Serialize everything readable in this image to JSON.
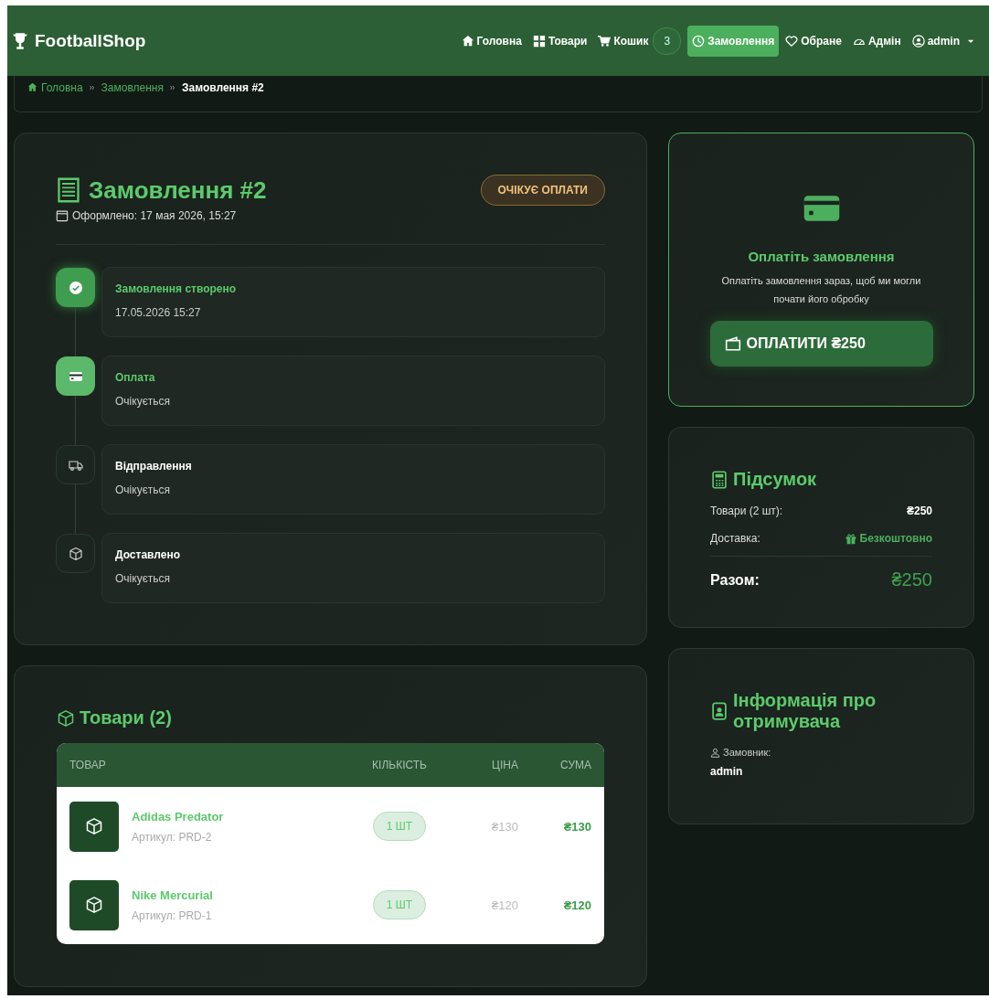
{
  "navbar": {
    "brand": "FootballShop",
    "items": [
      {
        "label": "Головна",
        "selected": false
      },
      {
        "label": "Товари",
        "selected": false
      },
      {
        "label": "Кошик",
        "selected": false,
        "badge": "3"
      },
      {
        "label": "Замовлення",
        "selected": true
      },
      {
        "label": "Обране",
        "selected": false
      },
      {
        "label": "Адмін",
        "selected": false
      },
      {
        "label": "admin",
        "selected": false
      }
    ]
  },
  "breadcrumb": [
    "Головна",
    "Замовлення",
    "Замовлення #2"
  ],
  "order": {
    "title": "Замовлення #2",
    "status": "ОЧІКУЄ ОПЛАТИ",
    "placed": "Оформлено: 17 мая 2026, 15:27",
    "timeline": [
      {
        "title": "Замовлення створено",
        "detail": "17.05.2026 15:27",
        "completed": true,
        "current": false
      },
      {
        "title": "Оплата",
        "detail": "Очікується",
        "completed": false,
        "current": true
      },
      {
        "title": "Відправлення",
        "detail": "Очікується",
        "completed": false,
        "current": false
      },
      {
        "title": "Доставлено",
        "detail": "Очікується",
        "completed": false,
        "current": false
      }
    ]
  },
  "products": {
    "title": "Товари (2)",
    "columns": [
      "ТОВАР",
      "КІЛЬКІСТЬ",
      "ЦІНА",
      "СУМА"
    ],
    "rows": [
      {
        "name": "Adidas Predator",
        "sku": "Артикул: PRD-2",
        "qty": "1 ШТ",
        "price": "₴130",
        "sum": "₴130"
      },
      {
        "name": "Nike Mercurial",
        "sku": "Артикул: PRD-1",
        "qty": "1 ШТ",
        "price": "₴120",
        "sum": "₴120"
      }
    ]
  },
  "payment": {
    "title": "Оплатіть замовлення",
    "text": "Оплатіть замовлення зараз, щоб ми могли почати його обробку",
    "button": "ОПЛАТИТИ ₴250"
  },
  "summary": {
    "title": "Підсумок",
    "rows": [
      {
        "label": "Товари (2 шт):",
        "value": "₴250",
        "kind": "amount"
      },
      {
        "label": "Доставка:",
        "value": "Безкоштовно",
        "kind": "free"
      }
    ],
    "total_label": "Разом:",
    "total": "₴250"
  },
  "recipient": {
    "title": "Інформація про отримувача",
    "label": "Замовник:",
    "value": "admin"
  }
}
